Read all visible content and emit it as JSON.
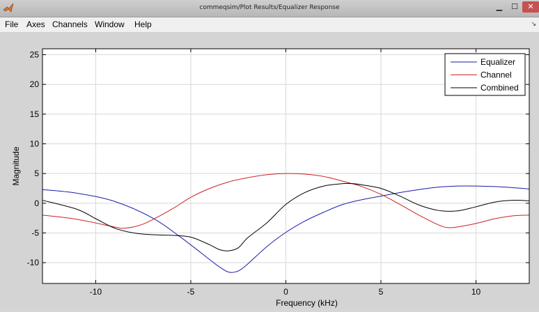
{
  "window": {
    "title": "commeqsim/Plot Results/Equalizer Response"
  },
  "menu": [
    "File",
    "Axes",
    "Channels",
    "Window",
    "Help"
  ],
  "chart_data": {
    "type": "line",
    "xlabel": "Frequency (kHz)",
    "ylabel": "Magnitude",
    "xlim": [
      -12.8,
      12.8
    ],
    "ylim": [
      -13.5,
      26
    ],
    "xticks": [
      -10,
      -5,
      0,
      5,
      10
    ],
    "yticks": [
      -10,
      -5,
      0,
      5,
      10,
      15,
      20,
      25
    ],
    "grid": true,
    "legend_position": "top-right",
    "series": [
      {
        "name": "Equalizer",
        "color": "#1a1aaa",
        "x": [
          -12.8,
          -11,
          -9,
          -7,
          -5.5,
          -4,
          -3.5,
          -3,
          -2.5,
          -2,
          -1,
          0,
          1,
          2,
          3,
          4,
          5,
          6,
          7,
          8,
          9,
          10,
          11,
          12,
          12.8
        ],
        "y": [
          2.3,
          1.7,
          0.3,
          -2.5,
          -5.8,
          -9.5,
          -10.7,
          -11.6,
          -11.4,
          -10.2,
          -7.3,
          -4.9,
          -3,
          -1.5,
          -0.2,
          0.6,
          1.2,
          1.8,
          2.3,
          2.7,
          2.9,
          2.9,
          2.8,
          2.6,
          2.4
        ]
      },
      {
        "name": "Channel",
        "color": "#cc2020",
        "x": [
          -12.8,
          -11,
          -9,
          -8.5,
          -7.5,
          -6,
          -5,
          -4,
          -3,
          -2,
          -1,
          0,
          1,
          2,
          3,
          4,
          5,
          6,
          7,
          8,
          8.5,
          9,
          10,
          11,
          12,
          12.8
        ],
        "y": [
          -2,
          -2.7,
          -4,
          -4.2,
          -3.5,
          -1,
          1,
          2.5,
          3.6,
          4.3,
          4.8,
          5,
          4.9,
          4.5,
          3.7,
          2.8,
          1.5,
          -0.2,
          -2,
          -3.6,
          -4.1,
          -4,
          -3.4,
          -2.6,
          -2.1,
          -2
        ]
      },
      {
        "name": "Combined",
        "color": "#000000",
        "x": [
          -12.8,
          -11,
          -10,
          -9,
          -8,
          -7,
          -6,
          -5,
          -4,
          -3.5,
          -3,
          -2.5,
          -2,
          -1,
          0,
          1,
          2,
          3,
          3.5,
          4,
          5,
          6,
          7,
          8,
          9,
          10,
          11,
          12,
          12.8
        ],
        "y": [
          0.5,
          -1,
          -2.6,
          -4.2,
          -5,
          -5.3,
          -5.4,
          -5.7,
          -7,
          -7.8,
          -8,
          -7.5,
          -5.8,
          -3.3,
          -0.2,
          1.8,
          2.9,
          3.3,
          3.3,
          3.1,
          2.5,
          1.2,
          -0.3,
          -1.2,
          -1.3,
          -0.6,
          0.2,
          0.5,
          0.4
        ]
      }
    ]
  }
}
